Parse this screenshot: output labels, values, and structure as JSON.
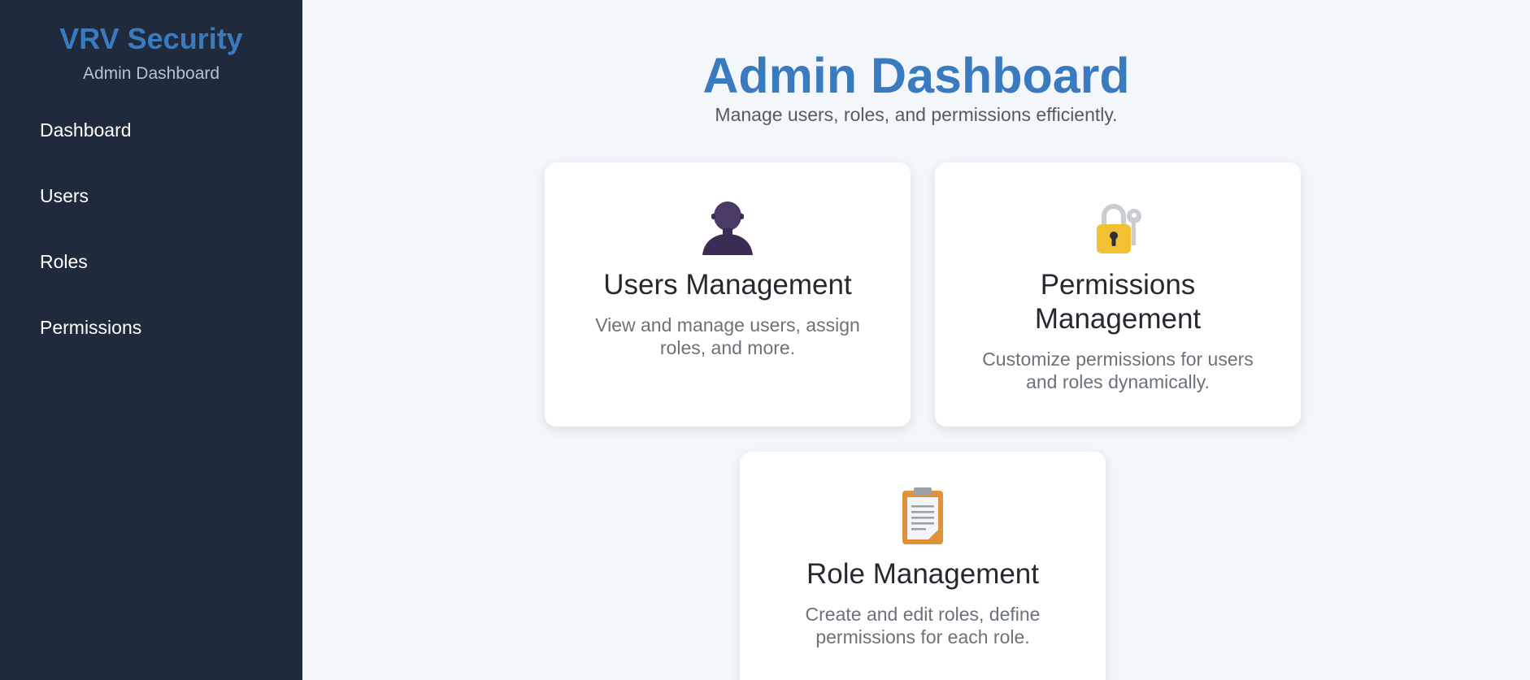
{
  "sidebar": {
    "brand": "VRV Security",
    "subtitle": "Admin Dashboard",
    "items": [
      {
        "label": "Dashboard"
      },
      {
        "label": "Users"
      },
      {
        "label": "Roles"
      },
      {
        "label": "Permissions"
      }
    ]
  },
  "main": {
    "title": "Admin Dashboard",
    "subtitle": "Manage users, roles, and permissions efficiently.",
    "cards": [
      {
        "icon": "user-icon",
        "title": "Users Management",
        "description": "View and manage users, assign roles, and more."
      },
      {
        "icon": "lock-key-icon",
        "title": "Permissions Management",
        "description": "Customize permissions for users and roles dynamically."
      },
      {
        "icon": "clipboard-icon",
        "title": "Role Management",
        "description": "Create and edit roles, define permissions for each role."
      }
    ]
  },
  "colors": {
    "sidebar_bg": "#1f2a3c",
    "accent": "#3a7bc0",
    "page_bg": "#f3f6fa"
  }
}
